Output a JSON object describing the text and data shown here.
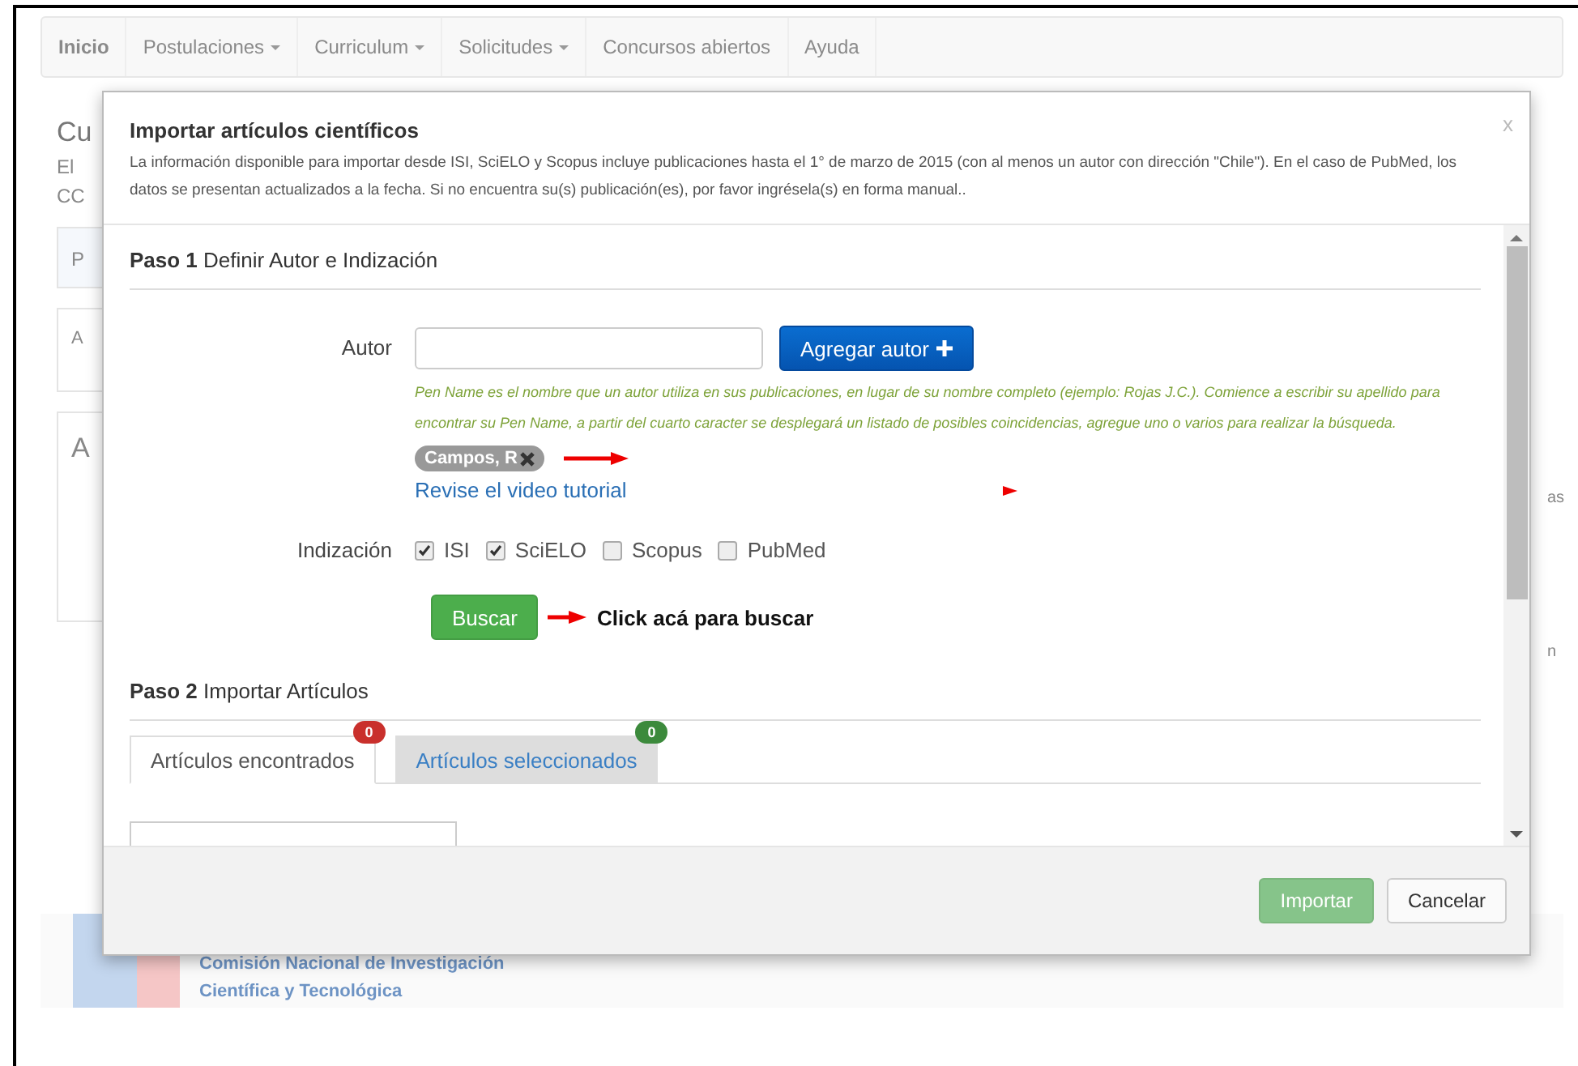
{
  "nav": {
    "items": [
      {
        "label": "Inicio",
        "dropdown": false
      },
      {
        "label": "Postulaciones",
        "dropdown": true
      },
      {
        "label": "Curriculum",
        "dropdown": true
      },
      {
        "label": "Solicitudes",
        "dropdown": true
      },
      {
        "label": "Concursos abiertos",
        "dropdown": false
      },
      {
        "label": "Ayuda",
        "dropdown": false
      }
    ]
  },
  "background": {
    "heading": "Cu",
    "lines": [
      "El",
      "CC"
    ],
    "cards": [
      {
        "label": "P"
      },
      {
        "label": "A"
      },
      {
        "label": "A"
      }
    ],
    "right_fragments": [
      "as",
      "n"
    ]
  },
  "footer": {
    "lines": [
      "Comisión Nacional de Investigación",
      "Científica y Tecnológica"
    ]
  },
  "modal": {
    "title": "Importar artículos científicos",
    "close": "x",
    "description": "La información disponible para importar desde ISI, SciELO y Scopus incluye publicaciones hasta el 1° de marzo de 2015 (con al menos un autor con dirección \"Chile\"). En el caso de PubMed, los datos se presentan actualizados a la fecha. Si no encuentra su(s) publicación(es), por favor ingrésela(s) en forma manual..",
    "step1": {
      "number": "Paso 1",
      "title": "Definir Autor e Indización"
    },
    "author": {
      "label": "Autor",
      "button": "Agregar autor",
      "help": "Pen Name es el nombre que un autor utiliza en sus publicaciones, en lugar de su nombre completo (ejemplo: Rojas J.C.). Comience a escribir su apellido para encontrar su Pen Name, a partir del cuarto caracter se desplegará un listado de posibles coincidencias, agregue uno o varios para realizar la búsqueda.",
      "chips": [
        {
          "label": "Campos, R"
        }
      ],
      "link": "Revise el video tutorial"
    },
    "indexing": {
      "label": "Indización",
      "options": [
        {
          "label": "ISI",
          "checked": true
        },
        {
          "label": "SciELO",
          "checked": true
        },
        {
          "label": "Scopus",
          "checked": false
        },
        {
          "label": "PubMed",
          "checked": false
        }
      ]
    },
    "search": {
      "button": "Buscar",
      "annotation": "Click acá para buscar"
    },
    "step2": {
      "number": "Paso 2",
      "title": "Importar Artículos"
    },
    "tabs": [
      {
        "label": "Artículos encontrados",
        "selected": true,
        "badge": "0",
        "color": "#c9302c"
      },
      {
        "label": "Artículos seleccionados",
        "selected": false,
        "badge": "0",
        "color": "#3c8a3c"
      }
    ],
    "buttons": [
      {
        "label": "Importar",
        "kind": "primary",
        "disabled": true
      },
      {
        "label": "Cancelar",
        "kind": "default",
        "disabled": false
      }
    ]
  }
}
